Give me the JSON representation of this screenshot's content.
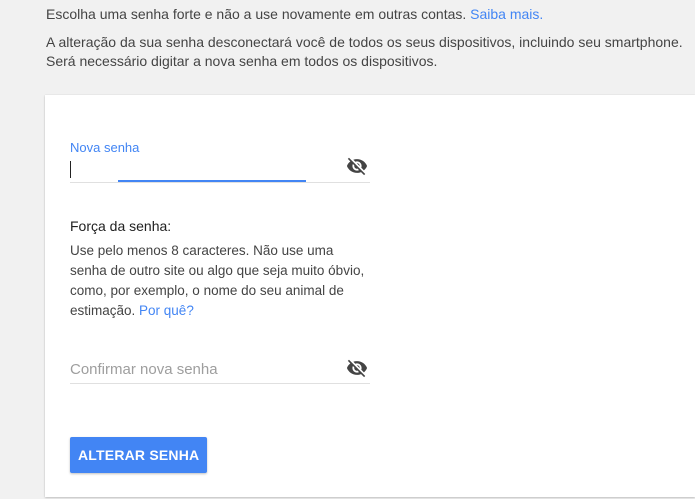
{
  "intro": {
    "line1_text": "Escolha uma senha forte e não a use novamente em outras contas. ",
    "line1_link": "Saiba mais.",
    "line2": "A alteração da sua senha desconectará você de todos os seus dispositivos, incluindo seu smartphone.",
    "line3": "Será necessário digitar a nova senha em todos os dispositivos."
  },
  "form": {
    "new_password": {
      "label": "Nova senha",
      "value": "",
      "eye_icon": "eye-off-icon"
    },
    "strength": {
      "title": "Força da senha:",
      "text": "Use pelo menos 8 caracteres. Não use uma senha de outro site ou algo que seja muito óbvio, como, por exemplo, o nome do seu animal de estimação. ",
      "link": "Por quê?"
    },
    "confirm_password": {
      "placeholder": "Confirmar nova senha",
      "value": "",
      "eye_icon": "eye-off-icon"
    },
    "submit_label": "ALTERAR SENHA"
  },
  "colors": {
    "accent": "#4285f4",
    "background": "#f1f1f1",
    "card": "#ffffff"
  }
}
